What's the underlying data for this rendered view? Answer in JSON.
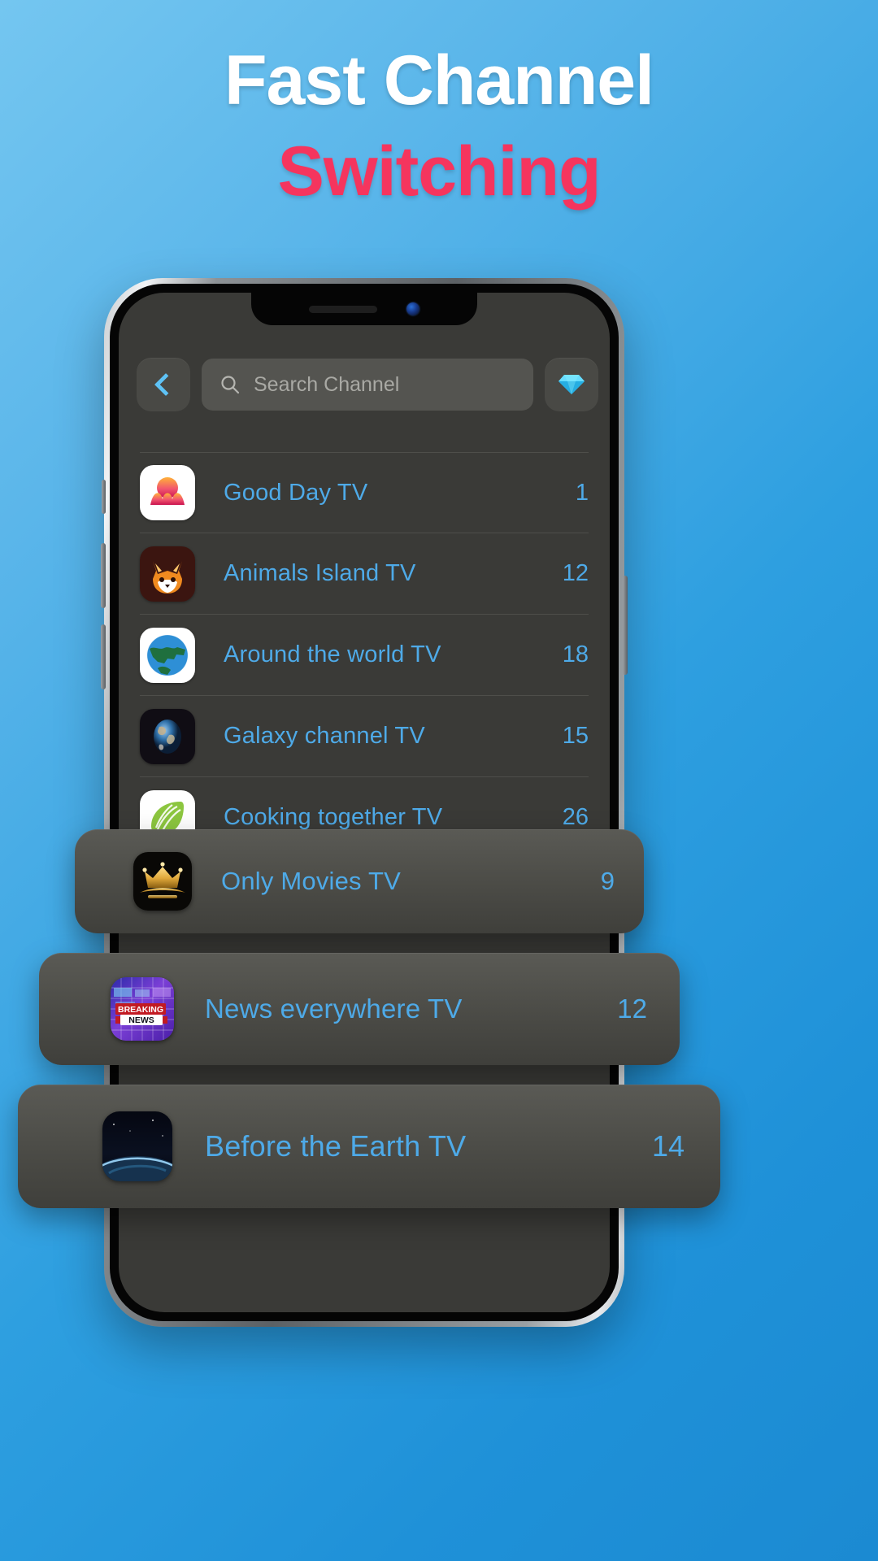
{
  "headline": {
    "line1": "Fast Channel",
    "line2": "Switching"
  },
  "colors": {
    "background_top": "#74c6f0",
    "background_bottom": "#1b8ad2",
    "headline_primary": "#ffffff",
    "headline_accent": "#f5355e",
    "channel_text": "#4eaae8",
    "screen_bg": "#3a3a37",
    "search_bg": "#545450",
    "card_bg": "#4b4b46"
  },
  "app": {
    "header": {
      "back_button": "back-chevron",
      "search": {
        "placeholder": "Search Channel",
        "value": "",
        "icon": "search-icon"
      },
      "premium_button": {
        "icon": "diamond-icon",
        "label": ""
      }
    },
    "channels": [
      {
        "name": "Good Day TV",
        "number": "1",
        "icon": "sunrise-icon"
      },
      {
        "name": "Animals Island TV",
        "number": "12",
        "icon": "fox-icon"
      },
      {
        "name": "Around the world TV",
        "number": "18",
        "icon": "globe-icon"
      },
      {
        "name": "Galaxy channel TV",
        "number": "15",
        "icon": "earth-icon"
      },
      {
        "name": "Cooking together TV",
        "number": "26",
        "icon": "whisk-leaf-icon"
      }
    ],
    "highlighted_channels": [
      {
        "name": "Only Movies TV",
        "number": "9",
        "icon": "crown-icon"
      },
      {
        "name": "News everywhere TV",
        "number": "12",
        "icon": "breaking-news-icon"
      },
      {
        "name": "Before the Earth TV",
        "number": "14",
        "icon": "earth-horizon-icon"
      }
    ]
  }
}
